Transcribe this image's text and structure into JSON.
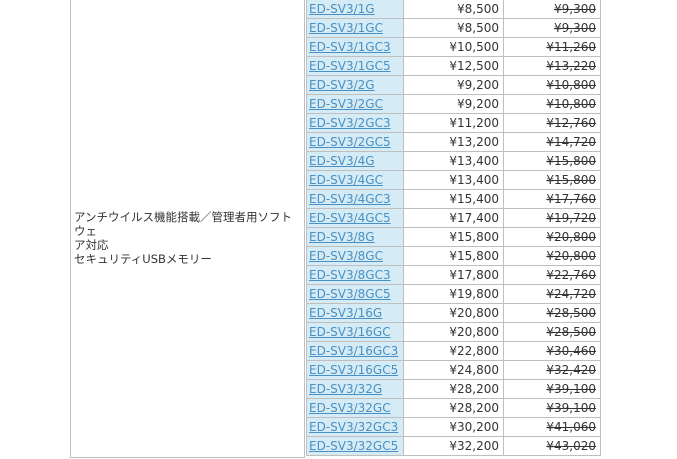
{
  "category": {
    "line1": "アンチウイルス機能搭載／管理者用ソフトウェ",
    "line2": "ア対応",
    "line3": "セキュリティUSBメモリー"
  },
  "rows": [
    {
      "model": "ED-SV3/1G",
      "price": "¥8,500",
      "old_price": "¥9,300"
    },
    {
      "model": "ED-SV3/1GC",
      "price": "¥8,500",
      "old_price": "¥9,300"
    },
    {
      "model": "ED-SV3/1GC3",
      "price": "¥10,500",
      "old_price": "¥11,260"
    },
    {
      "model": "ED-SV3/1GC5",
      "price": "¥12,500",
      "old_price": "¥13,220"
    },
    {
      "model": "ED-SV3/2G",
      "price": "¥9,200",
      "old_price": "¥10,800"
    },
    {
      "model": "ED-SV3/2GC",
      "price": "¥9,200",
      "old_price": "¥10,800"
    },
    {
      "model": "ED-SV3/2GC3",
      "price": "¥11,200",
      "old_price": "¥12,760"
    },
    {
      "model": "ED-SV3/2GC5",
      "price": "¥13,200",
      "old_price": "¥14,720"
    },
    {
      "model": "ED-SV3/4G",
      "price": "¥13,400",
      "old_price": "¥15,800"
    },
    {
      "model": "ED-SV3/4GC",
      "price": "¥13,400",
      "old_price": "¥15,800"
    },
    {
      "model": "ED-SV3/4GC3",
      "price": "¥15,400",
      "old_price": "¥17,760"
    },
    {
      "model": "ED-SV3/4GC5",
      "price": "¥17,400",
      "old_price": "¥19,720"
    },
    {
      "model": "ED-SV3/8G",
      "price": "¥15,800",
      "old_price": "¥20,800"
    },
    {
      "model": "ED-SV3/8GC",
      "price": "¥15,800",
      "old_price": "¥20,800"
    },
    {
      "model": "ED-SV3/8GC3",
      "price": "¥17,800",
      "old_price": "¥22,760"
    },
    {
      "model": "ED-SV3/8GC5",
      "price": "¥19,800",
      "old_price": "¥24,720"
    },
    {
      "model": "ED-SV3/16G",
      "price": "¥20,800",
      "old_price": "¥28,500"
    },
    {
      "model": "ED-SV3/16GC",
      "price": "¥20,800",
      "old_price": "¥28,500"
    },
    {
      "model": "ED-SV3/16GC3",
      "price": "¥22,800",
      "old_price": "¥30,460"
    },
    {
      "model": "ED-SV3/16GC5",
      "price": "¥24,800",
      "old_price": "¥32,420"
    },
    {
      "model": "ED-SV3/32G",
      "price": "¥28,200",
      "old_price": "¥39,100"
    },
    {
      "model": "ED-SV3/32GC",
      "price": "¥28,200",
      "old_price": "¥39,100"
    },
    {
      "model": "ED-SV3/32GC3",
      "price": "¥30,200",
      "old_price": "¥41,060"
    },
    {
      "model": "ED-SV3/32GC5",
      "price": "¥32,200",
      "old_price": "¥43,020"
    }
  ],
  "colors": {
    "model_cell_bg": "#d5ecf6",
    "link": "#4a90c2",
    "border": "#bfbfbf",
    "text": "#333333"
  }
}
